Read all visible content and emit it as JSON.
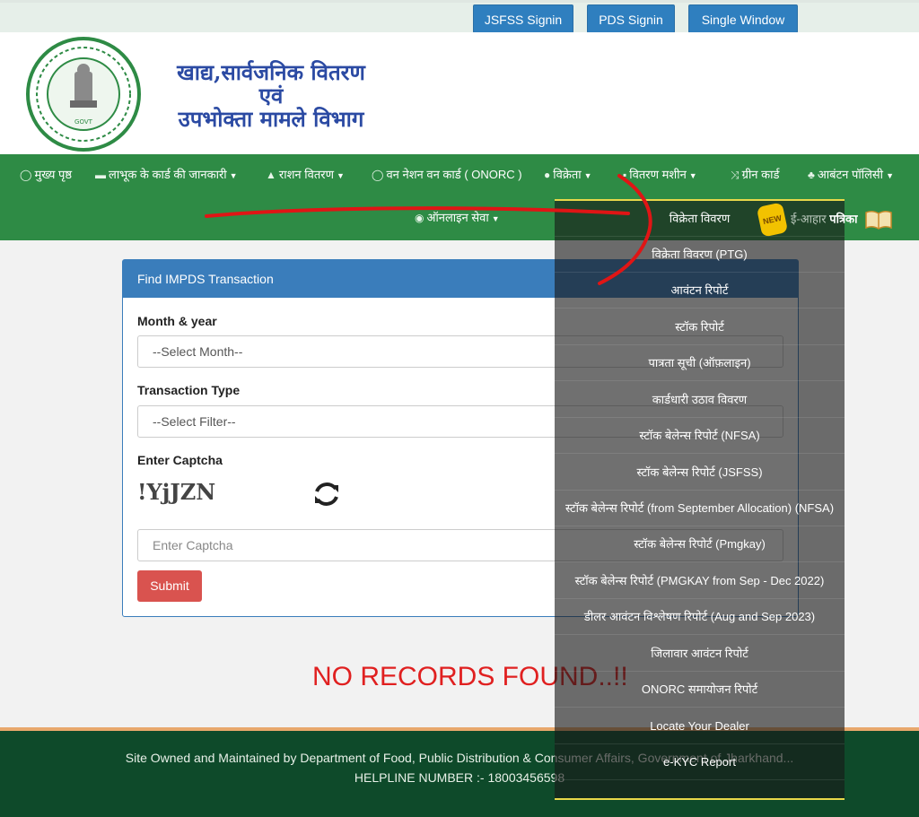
{
  "topbar": {
    "buttons": [
      "JSFSS Signin",
      "PDS Signin",
      "Single Window"
    ]
  },
  "header": {
    "title_line1": "खाद्य,सार्वजनिक वितरण",
    "title_line2": "एवं",
    "title_line3": "उपभोक्ता मामले विभाग"
  },
  "nav": {
    "items": [
      "मुख्य पृष्ठ",
      "लाभूक के कार्ड की जानकारी",
      "राशन वितरण",
      "वन नेशन वन कार्ड ( ONORC )",
      "विक्रेता",
      "वितरण मशीन",
      "ग्रीन कार्ड",
      "आबंटन पॉलिसी",
      "ऑनलाइन सेवा"
    ],
    "eahar_prefix": "ई-आहार",
    "eahar_suffix": "पत्रिका",
    "new_badge": "NEW"
  },
  "form": {
    "panel_title": "Find IMPDS Transaction",
    "month_label": "Month & year",
    "month_placeholder": "--Select Month--",
    "type_label": "Transaction Type",
    "type_placeholder": "--Select Filter--",
    "captcha_label": "Enter Captcha",
    "captcha_text": "!YjJZN",
    "captcha_placeholder": "Enter Captcha",
    "submit_label": "Submit"
  },
  "result": {
    "message": "NO RECORDS FOUND..!!"
  },
  "dropdown": {
    "items": [
      "विक्रेता विवरण",
      "विक्रेता विवरण (PTG)",
      "आवंटन रिपोर्ट",
      "स्टॉक रिपोर्ट",
      "पात्रता सूची (ऑफ़लाइन)",
      "कार्डधारी उठाव विवरण",
      "स्टॉक बेलेन्स रिपोर्ट (NFSA)",
      "स्टॉक बेलेन्स रिपोर्ट (JSFSS)",
      "स्टॉक बेलेन्स रिपोर्ट (from September Allocation) (NFSA)",
      "स्टॉक बेलेन्स रिपोर्ट (Pmgkay)",
      "स्टॉक बेलेन्स रिपोर्ट (PMGKAY from Sep - Dec 2022)",
      "डीलर आवंटन विश्लेषण रिपोर्ट (Aug and Sep 2023)",
      "जिलावार आवंटन रिपोर्ट",
      "ONORC समायोजन रिपोर्ट",
      "Locate Your Dealer",
      "e-KYC Report"
    ]
  },
  "footer": {
    "line1": "Site Owned and Maintained by Department of Food, Public Distribution & Consumer Affairs, Government of Jharkhand...",
    "line2": "HELPLINE NUMBER :- 18003456598"
  },
  "colors": {
    "nav_green": "#2e8b45",
    "footer_green": "#0e4a2a",
    "primary_blue": "#3a7dbb",
    "danger_red": "#d9534f"
  }
}
